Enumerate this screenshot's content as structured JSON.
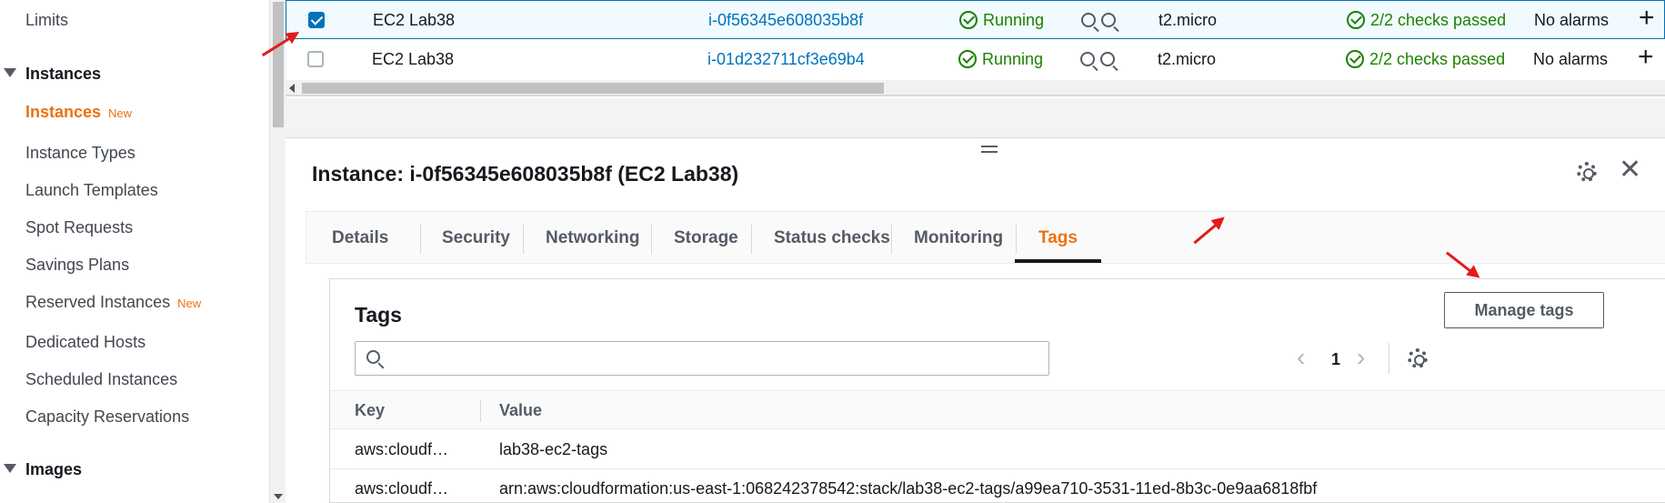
{
  "sidebar": {
    "items": [
      {
        "label": "Limits"
      },
      {
        "label": "Instances",
        "section": true
      },
      {
        "label": "Instances",
        "badge": "New",
        "active": true
      },
      {
        "label": "Instance Types"
      },
      {
        "label": "Launch Templates"
      },
      {
        "label": "Spot Requests"
      },
      {
        "label": "Savings Plans"
      },
      {
        "label": "Reserved Instances",
        "badge": "New"
      },
      {
        "label": "Dedicated Hosts"
      },
      {
        "label": "Scheduled Instances"
      },
      {
        "label": "Capacity Reservations"
      },
      {
        "label": "Images",
        "section": true
      }
    ]
  },
  "instances": {
    "rows": [
      {
        "name": "EC2 Lab38",
        "id": "i-0f56345e608035b8f",
        "state": "Running",
        "type": "t2.micro",
        "checks": "2/2 checks passed",
        "alarms": "No alarms",
        "selected": true
      },
      {
        "name": "EC2 Lab38",
        "id": "i-01d232711cf3e69b4",
        "state": "Running",
        "type": "t2.micro",
        "checks": "2/2 checks passed",
        "alarms": "No alarms",
        "selected": false
      }
    ],
    "add_alarm_icon": "plus-icon",
    "zoom_icons": [
      "zoom-in-icon",
      "zoom-out-icon"
    ]
  },
  "detail": {
    "title": "Instance: i-0f56345e608035b8f (EC2 Lab38)",
    "settings_icon": "gear-icon",
    "close_icon": "close-icon"
  },
  "tabs": [
    {
      "label": "Details"
    },
    {
      "label": "Security"
    },
    {
      "label": "Networking"
    },
    {
      "label": "Storage"
    },
    {
      "label": "Status checks"
    },
    {
      "label": "Monitoring"
    },
    {
      "label": "Tags",
      "active": true
    }
  ],
  "tags": {
    "title": "Tags",
    "manage_button": "Manage tags",
    "search_placeholder": "",
    "page": "1",
    "columns": {
      "key": "Key",
      "value": "Value"
    },
    "rows": [
      {
        "key": "aws:cloudf…",
        "value": "lab38-ec2-tags"
      },
      {
        "key": "aws:cloudf…",
        "value": "arn:aws:cloudformation:us-east-1:068242378542:stack/lab38-ec2-tags/a99ea710-3531-11ed-8b3c-0e9aa6818fbf"
      }
    ]
  },
  "colors": {
    "accent": "#ec7211",
    "link": "#0073bb",
    "success": "#1d8102",
    "annotation": "#e31b1b"
  }
}
